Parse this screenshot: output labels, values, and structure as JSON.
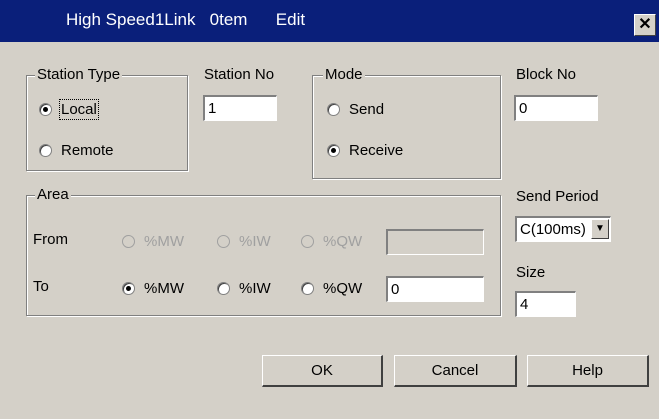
{
  "window": {
    "title": "High Speed1Link   0tem      Edit",
    "close_label": "✕"
  },
  "station_type": {
    "legend": "Station Type",
    "options": [
      "Local",
      "Remote"
    ],
    "selected": "Local"
  },
  "station_no": {
    "label": "Station No",
    "value": "1"
  },
  "mode": {
    "legend": "Mode",
    "options": [
      "Send",
      "Receive"
    ],
    "selected": "Receive"
  },
  "block_no": {
    "label": "Block No",
    "value": "0"
  },
  "area": {
    "legend": "Area",
    "from": {
      "label": "From",
      "options": [
        "%MW",
        "%IW",
        "%QW"
      ],
      "value": ""
    },
    "to": {
      "label": "To",
      "options": [
        "%MW",
        "%IW",
        "%QW"
      ],
      "selected": "%MW",
      "value": "0"
    }
  },
  "send_period": {
    "label": "Send Period",
    "value": "C(100ms)"
  },
  "size": {
    "label": "Size",
    "value": "4"
  },
  "buttons": {
    "ok": "OK",
    "cancel": "Cancel",
    "help": "Help"
  }
}
